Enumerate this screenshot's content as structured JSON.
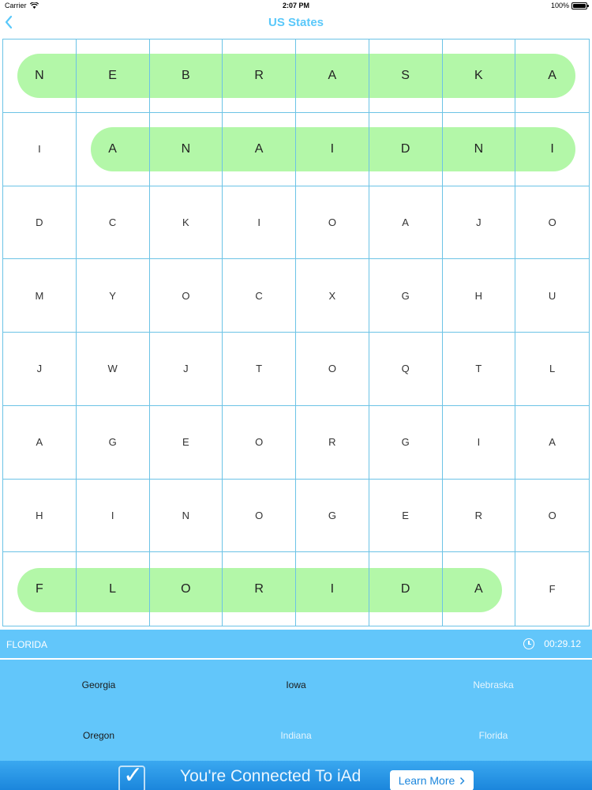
{
  "status_bar": {
    "carrier": "Carrier",
    "time": "2:07 PM",
    "battery": "100%"
  },
  "nav": {
    "back_icon": "chevron-left-icon",
    "title": "US States"
  },
  "grid": {
    "rows": [
      [
        "N",
        "E",
        "B",
        "R",
        "A",
        "S",
        "K",
        "A"
      ],
      [
        "I",
        "A",
        "N",
        "A",
        "I",
        "D",
        "N",
        "I"
      ],
      [
        "D",
        "C",
        "K",
        "I",
        "O",
        "A",
        "J",
        "O"
      ],
      [
        "M",
        "Y",
        "O",
        "C",
        "X",
        "G",
        "H",
        "U"
      ],
      [
        "J",
        "W",
        "J",
        "T",
        "O",
        "Q",
        "T",
        "L"
      ],
      [
        "A",
        "G",
        "E",
        "O",
        "R",
        "G",
        "I",
        "A"
      ],
      [
        "H",
        "I",
        "N",
        "O",
        "G",
        "E",
        "R",
        "O"
      ],
      [
        "F",
        "L",
        "O",
        "R",
        "I",
        "D",
        "A",
        "F"
      ]
    ],
    "highlight_color": "#b3f7a8",
    "line_color": "#6cc3e6"
  },
  "info_bar": {
    "current_word": "FLORIDA",
    "timer": "00:29.12"
  },
  "words": [
    {
      "label": "Georgia",
      "found": false
    },
    {
      "label": "Iowa",
      "found": false
    },
    {
      "label": "Nebraska",
      "found": true
    },
    {
      "label": "Oregon",
      "found": false
    },
    {
      "label": "Indiana",
      "found": true
    },
    {
      "label": "Florida",
      "found": true
    }
  ],
  "ad": {
    "text": "You're Connected To iAd",
    "button": "Learn More"
  },
  "colors": {
    "accent": "#5ac8fa",
    "panel": "#62c6fa",
    "ad": "#1b86dc"
  }
}
